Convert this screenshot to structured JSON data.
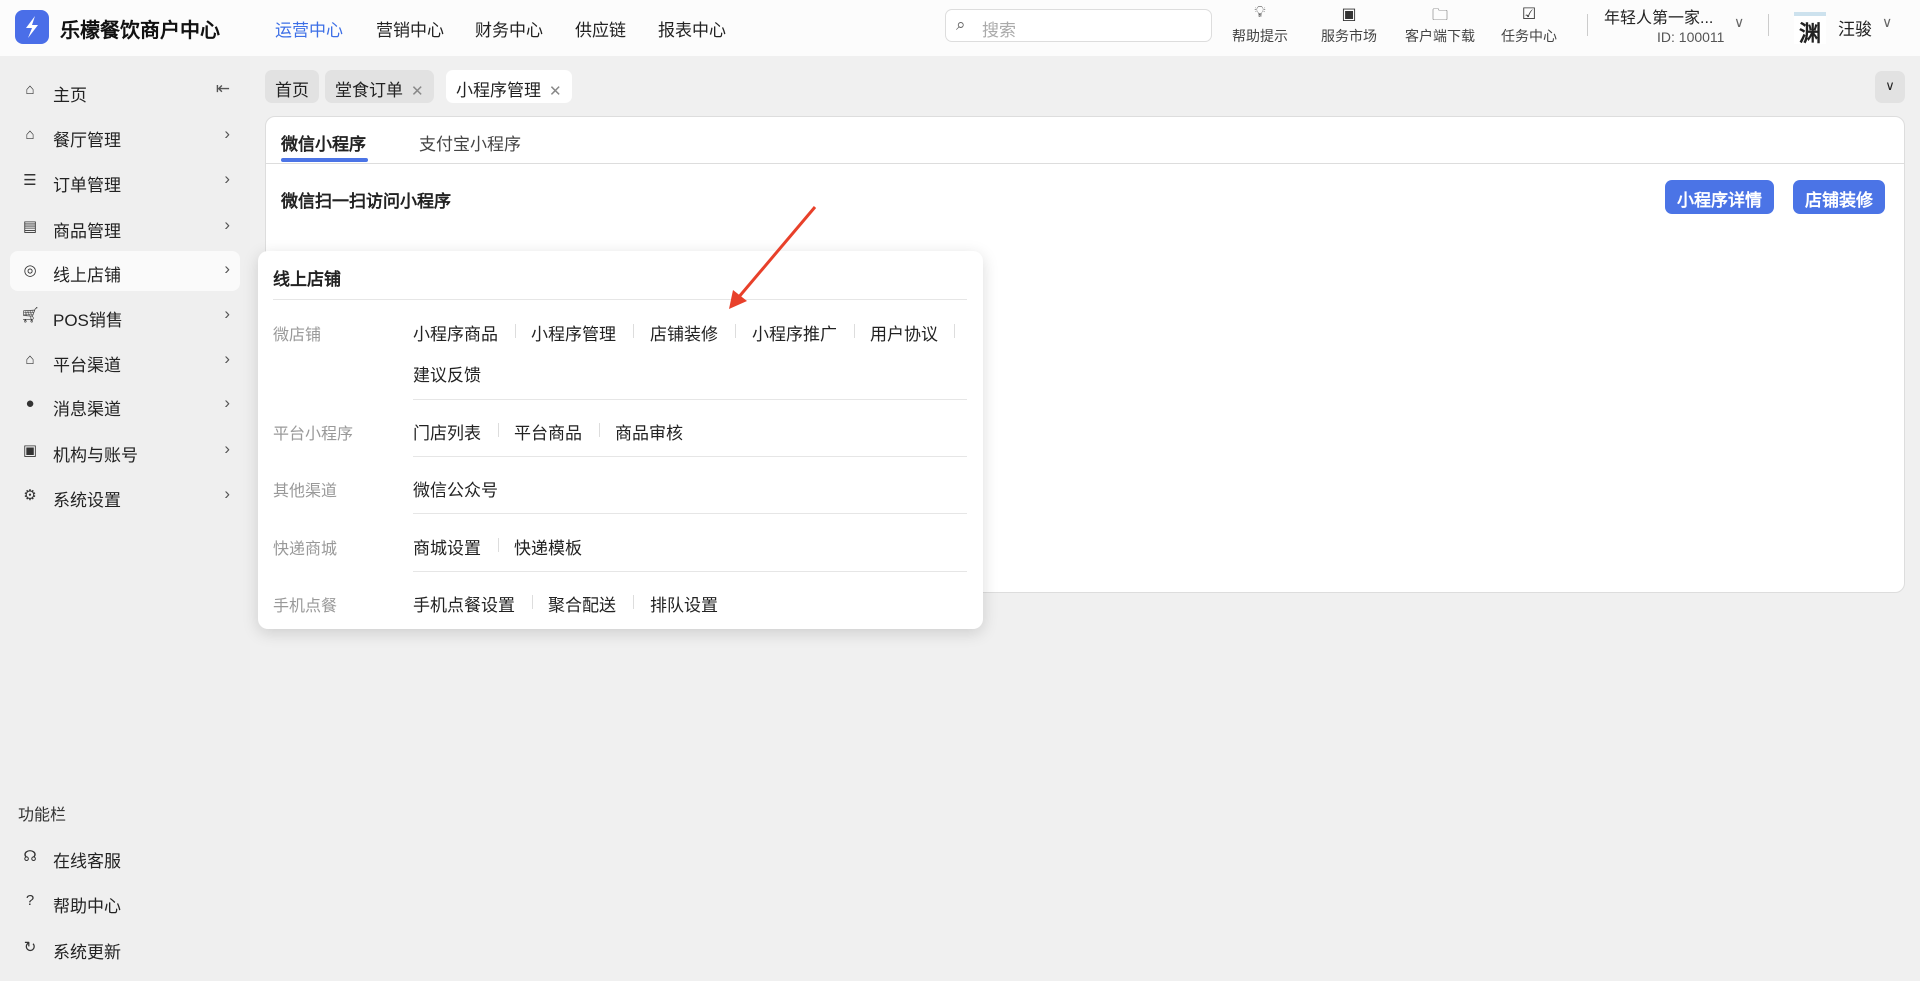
{
  "header": {
    "brand": "乐檬餐饮商户中心",
    "nav": [
      "运营中心",
      "营销中心",
      "财务中心",
      "供应链",
      "报表中心"
    ],
    "search_placeholder": "搜索",
    "tools": [
      {
        "label": "帮助提示",
        "icon": "lightbulb-icon"
      },
      {
        "label": "服务市场",
        "icon": "bag-icon"
      },
      {
        "label": "客户端下载",
        "icon": "folder-download-icon"
      },
      {
        "label": "任务中心",
        "icon": "clipboard-check-icon"
      }
    ],
    "store_name": "年轻人第一家...",
    "store_id": "ID: 100011",
    "user_name": "汪骏"
  },
  "sidebar": {
    "items": [
      {
        "label": "主页"
      },
      {
        "label": "餐厅管理"
      },
      {
        "label": "订单管理"
      },
      {
        "label": "商品管理"
      },
      {
        "label": "线上店铺"
      },
      {
        "label": "POS销售"
      },
      {
        "label": "平台渠道"
      },
      {
        "label": "消息渠道"
      },
      {
        "label": "机构与账号"
      },
      {
        "label": "系统设置"
      }
    ],
    "footer_title": "功能栏",
    "footer_items": [
      {
        "label": "在线客服"
      },
      {
        "label": "帮助中心"
      },
      {
        "label": "系统更新"
      }
    ]
  },
  "tabs": [
    {
      "label": "首页"
    },
    {
      "label": "堂食订单"
    },
    {
      "label": "小程序管理"
    }
  ],
  "main": {
    "tabs": [
      "微信小程序",
      "支付宝小程序"
    ],
    "section_title": "微信扫一扫访问小程序",
    "buttons": [
      "小程序详情",
      "店铺装修"
    ]
  },
  "popup": {
    "title": "线上店铺",
    "groups": [
      {
        "label": "微店铺",
        "links": [
          "小程序商品",
          "小程序管理",
          "店铺装修",
          "小程序推广",
          "用户协议",
          "建议反馈"
        ]
      },
      {
        "label": "平台小程序",
        "links": [
          "门店列表",
          "平台商品",
          "商品审核"
        ]
      },
      {
        "label": "其他渠道",
        "links": [
          "微信公众号"
        ]
      },
      {
        "label": "快递商城",
        "links": [
          "商城设置",
          "快递模板"
        ]
      },
      {
        "label": "手机点餐",
        "links": [
          "手机点餐设置",
          "聚合配送",
          "排队设置"
        ]
      }
    ]
  },
  "colors": {
    "accent": "#4b74e6",
    "annotation": "#e8402a"
  }
}
